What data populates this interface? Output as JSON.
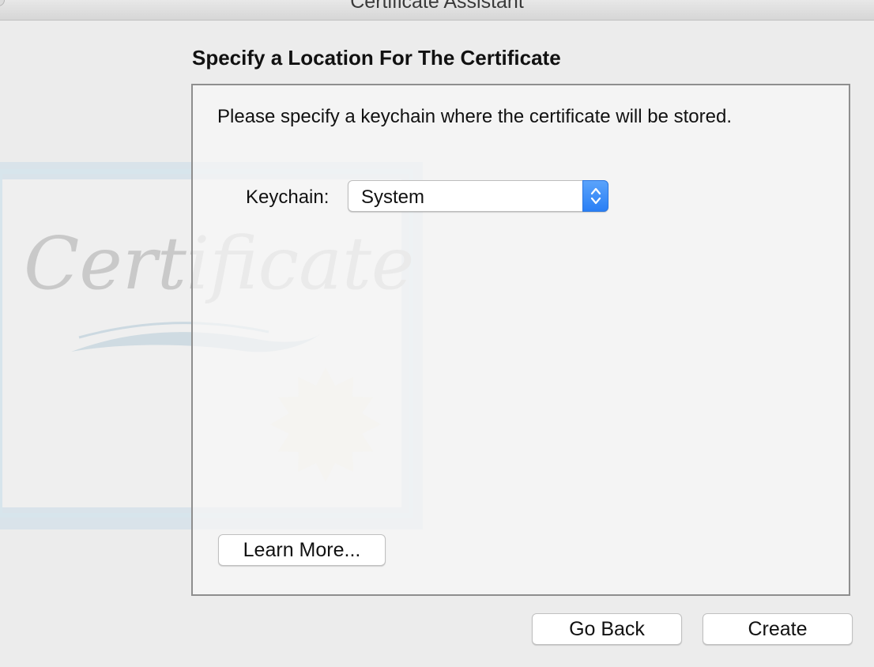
{
  "window": {
    "title": "Certificate Assistant"
  },
  "page": {
    "section_title": "Specify a Location For The Certificate",
    "instruction": "Please specify a keychain where the certificate will be stored.",
    "background_art_text": "Certificate"
  },
  "form": {
    "keychain_label": "Keychain:",
    "keychain_value": "System",
    "keychain_icon": "updown-chevron-icon"
  },
  "buttons": {
    "learn_more": "Learn More...",
    "go_back": "Go Back",
    "create": "Create"
  },
  "colors": {
    "window_bg": "#ececec",
    "accent": "#2a7ff5",
    "box_border": "#8e8e8e"
  }
}
